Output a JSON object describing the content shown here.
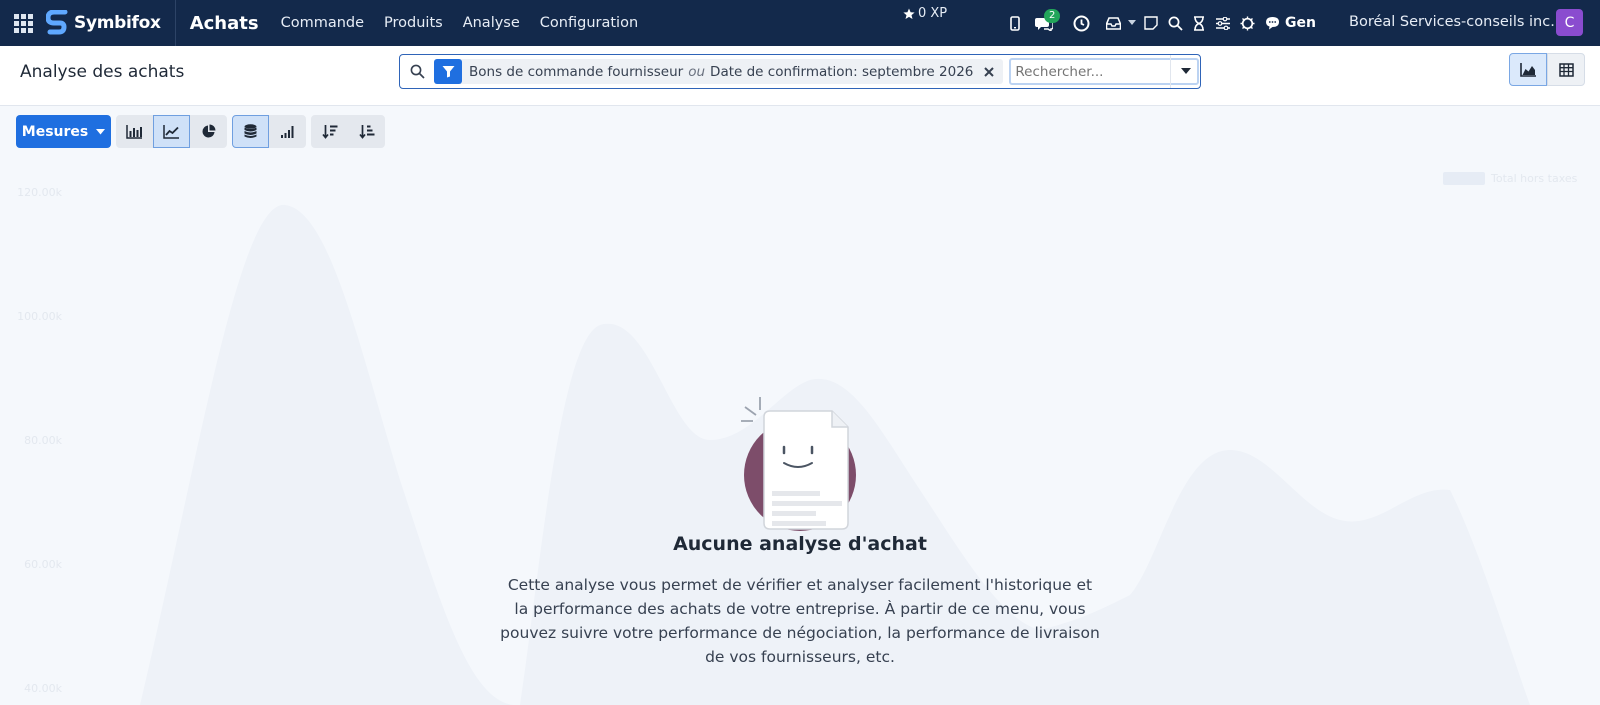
{
  "navbar": {
    "brand": "Symbifox",
    "app_name": "Achats",
    "menu": [
      "Commande",
      "Produits",
      "Analyse",
      "Configuration"
    ],
    "xp": "0 XP",
    "chat_badge": "2",
    "gen_label": "Gen",
    "company": "Boréal Services-conseils inc.",
    "avatar_letter": "C"
  },
  "control": {
    "breadcrumb": "Analyse des achats",
    "facet": {
      "value1": "Bons de commande fournisseur",
      "separator": "ou",
      "value2": "Date de confirmation: septembre 2026"
    },
    "search_placeholder": "Rechercher..."
  },
  "toolbar": {
    "measures_label": "Mesures"
  },
  "background_chart": {
    "y_ticks": [
      "120.00k",
      "100.00k",
      "80.00k",
      "60.00k",
      "40.00k"
    ],
    "legend": "Total hors taxes"
  },
  "empty_state": {
    "title": "Aucune analyse d'achat",
    "text": "Cette analyse vous permet de vérifier et analyser facilement l'historique et la performance des achats de votre entreprise. À partir de ce menu, vous pouvez suivre votre performance de négociation, la performance de livraison de vos fournisseurs, etc."
  },
  "colors": {
    "navbar_bg": "#13294b",
    "primary": "#1f6fe0",
    "avatar": "#8a4ccf",
    "badge": "#22a55a"
  }
}
